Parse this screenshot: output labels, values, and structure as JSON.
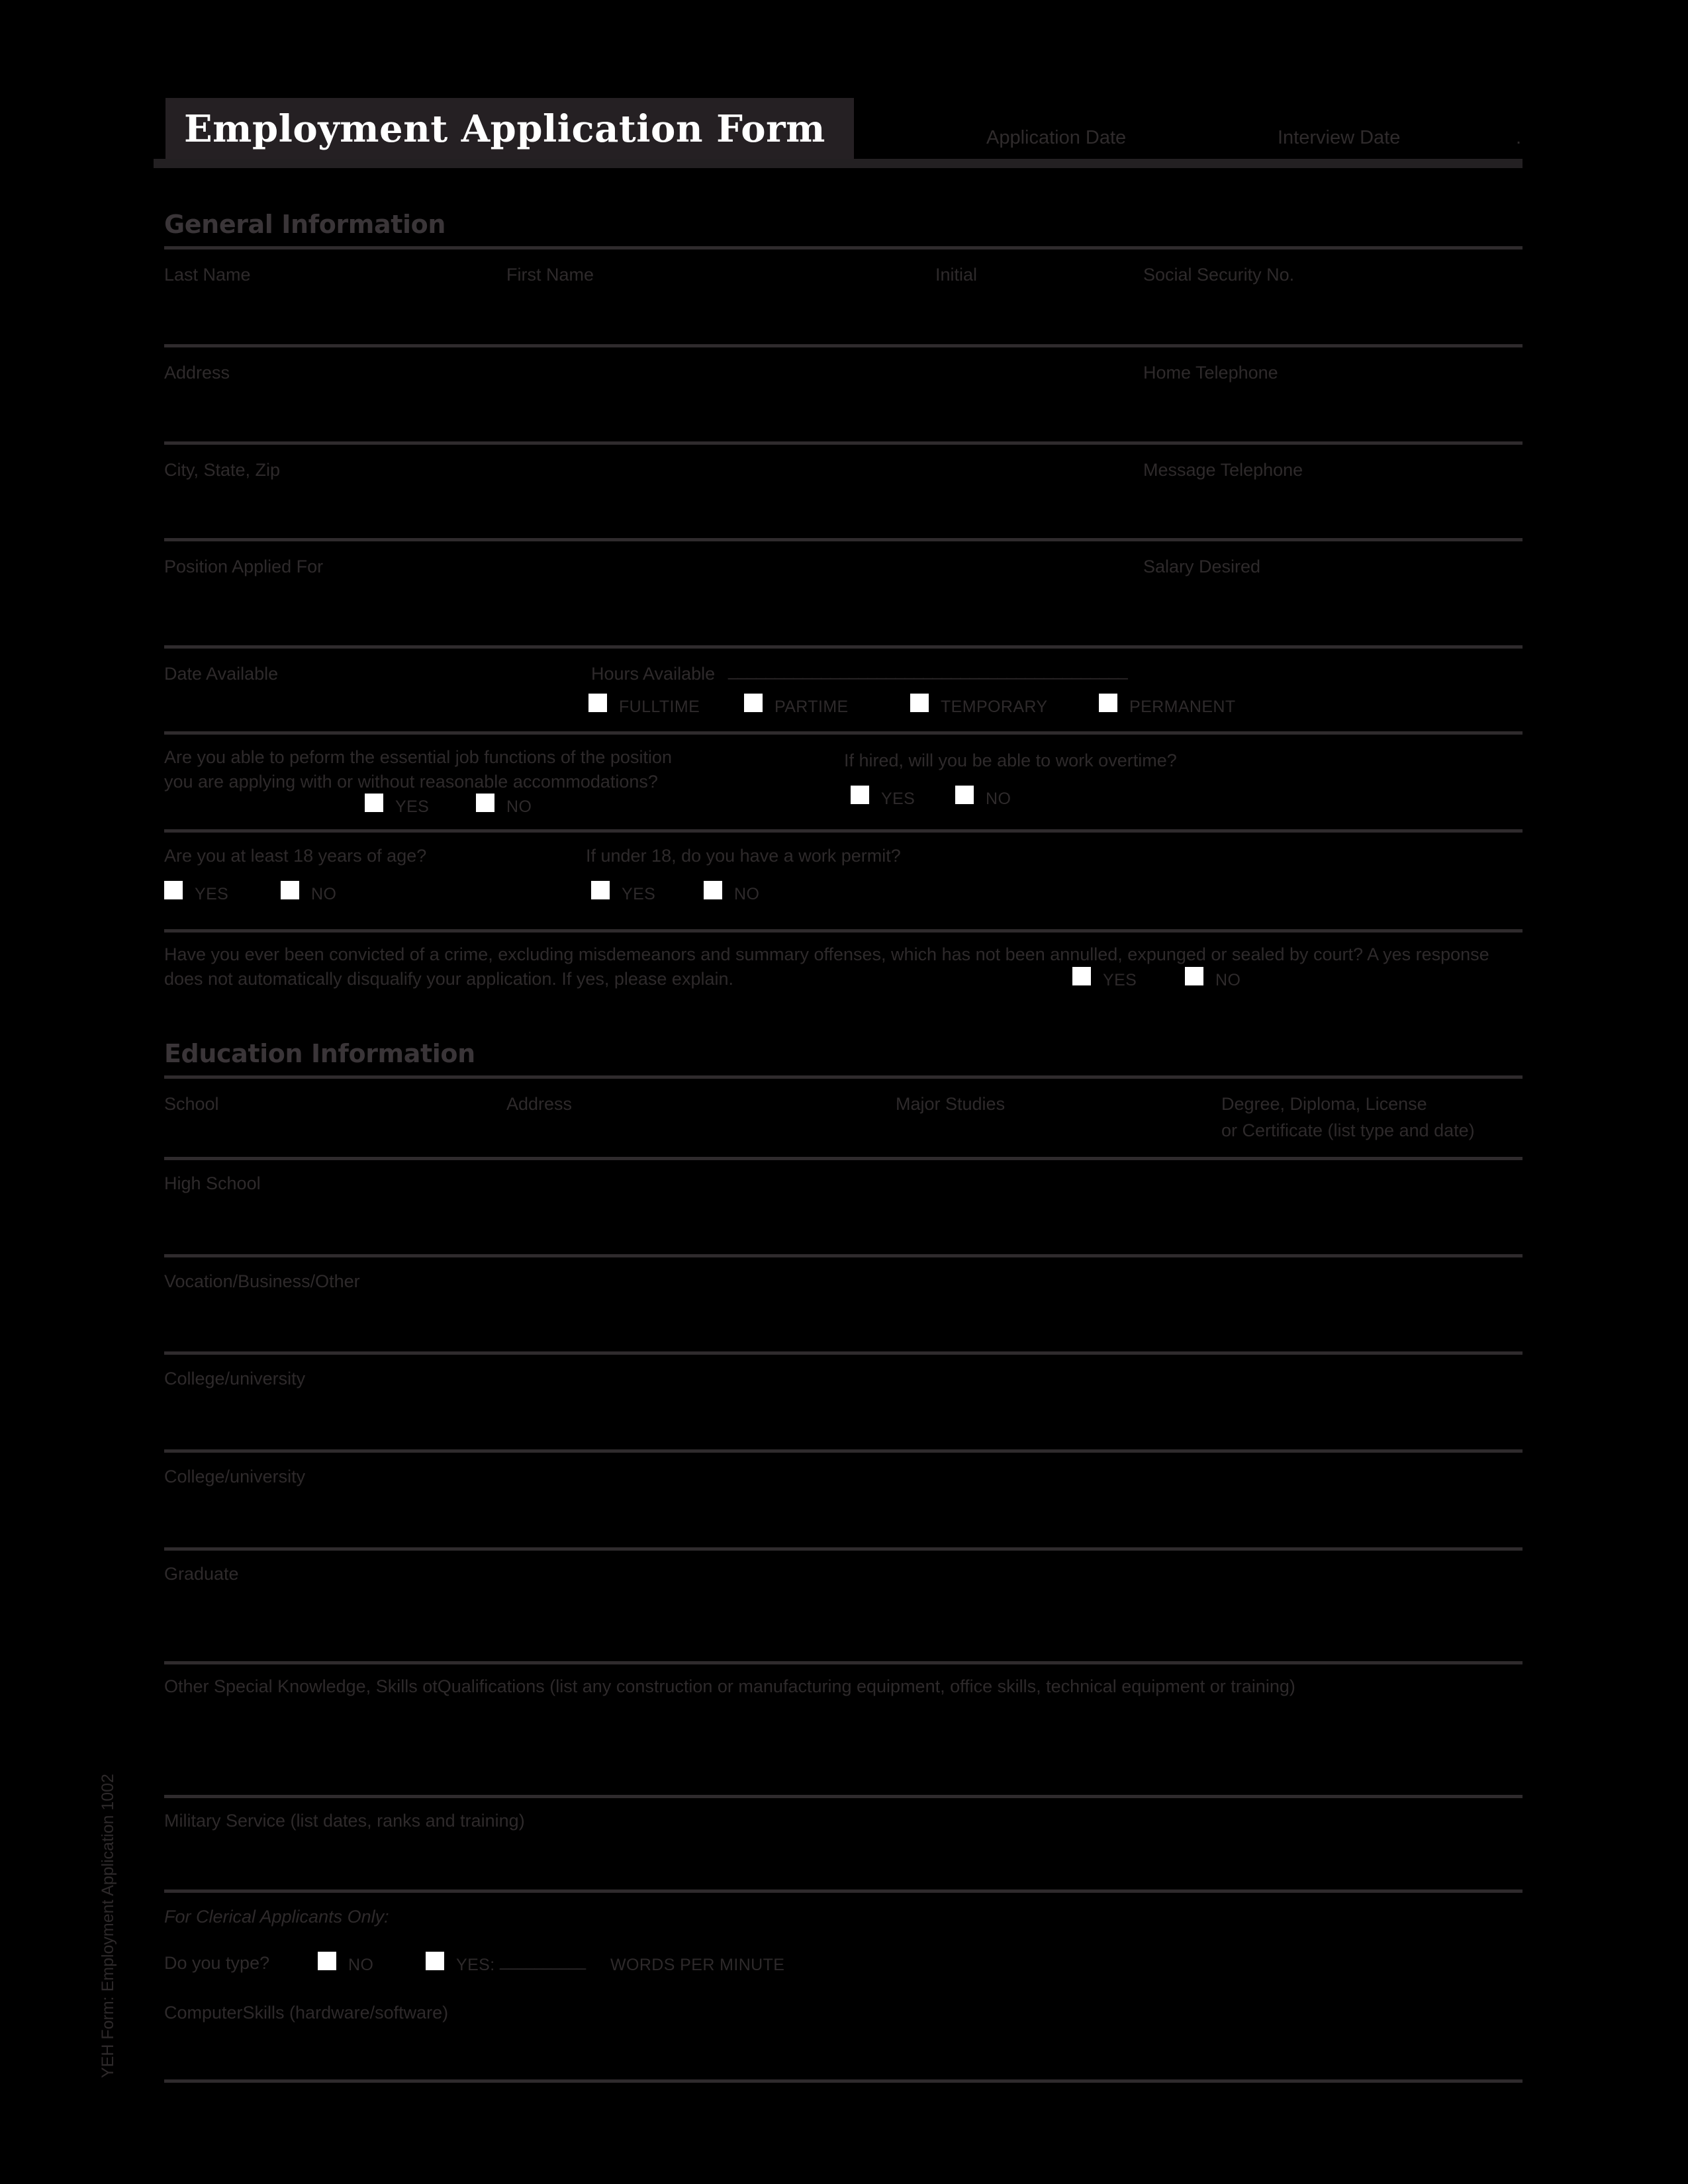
{
  "document": {
    "title": "Employment Application Form",
    "sidebar_code": "YEH Form: Employment Application 1002",
    "header_fields": {
      "application_date": "Application Date",
      "interview_date": "Interview Date",
      "trailing_mark": "."
    }
  },
  "general_information": {
    "section_title": "General Information",
    "name_row": {
      "last_name": "Last Name",
      "first_name": "First Name",
      "initial": "Initial",
      "ssn": "Social Security No."
    },
    "address_row": {
      "address": "Address",
      "home_telephone": "Home Telephone"
    },
    "city_row": {
      "city_state_zip": "City, State, Zip",
      "message_telephone": "Message Telephone"
    },
    "position_row": {
      "position_applied_for": "Position Applied For",
      "salary_desired": "Salary Desired"
    },
    "availability_row": {
      "date_available": "Date Available",
      "hours_available": "Hours Available",
      "hours_blank": "___________________________________________",
      "options": [
        "FULLTIME",
        "PARTIME",
        "TEMPORARY",
        "PERMANENT"
      ]
    },
    "essential_functions": {
      "question": "Are you able to peform the essential job functions of the position you are applying with or without reasonable accommodations?",
      "yes": "YES",
      "no": "NO"
    },
    "overtime": {
      "question": "If hired, will you be able to work overtime?",
      "yes": "YES",
      "no": "NO"
    },
    "age_18": {
      "question": "Are you at least 18 years of age?",
      "yes": "YES",
      "no": "NO"
    },
    "work_permit": {
      "question": "If under 18, do you have a work permit?",
      "yes": "YES",
      "no": "NO"
    },
    "conviction": {
      "question": "Have you ever been convicted of a crime, excluding misdemeanors and summary offenses, which has not been annulled, expunged or sealed by court? A yes response does not automatically disqualify your application. If yes, please explain.",
      "yes": "YES",
      "no": "NO"
    }
  },
  "education_information": {
    "section_title": "Education Information",
    "columns": {
      "school": "School",
      "address": "Address",
      "major_studies": "Major Studies",
      "degree_line1": "Degree, Diploma, License",
      "degree_line2": "or Certificate (list type and date)"
    },
    "rows": [
      "High School",
      "Vocation/Business/Other",
      "College/university",
      "College/university",
      "Graduate"
    ],
    "other_skills": "Other Special Knowledge, Skills otQualifications (list any construction or manufacturing equipment, office skills, technical equipment or training)",
    "military_service": "Military Service (list dates, ranks and training)"
  },
  "clerical_section": {
    "heading": "For Clerical Applicants Only:",
    "do_you_type": "Do you type?",
    "no": "NO",
    "yes": "YES:",
    "wpm_blank": "__________",
    "wpm_label": "WORDS PER MINUTE",
    "computer_skills": "ComputerSkills (hardware/software)"
  },
  "colors": {
    "page_background": "#000000",
    "title_box": "#252023",
    "title_text": "#ffffff",
    "label_text": "#2e2a2b",
    "section_heading": "#3a3538",
    "rule": "#2f2b2d",
    "checkbox": "#ffffff"
  }
}
